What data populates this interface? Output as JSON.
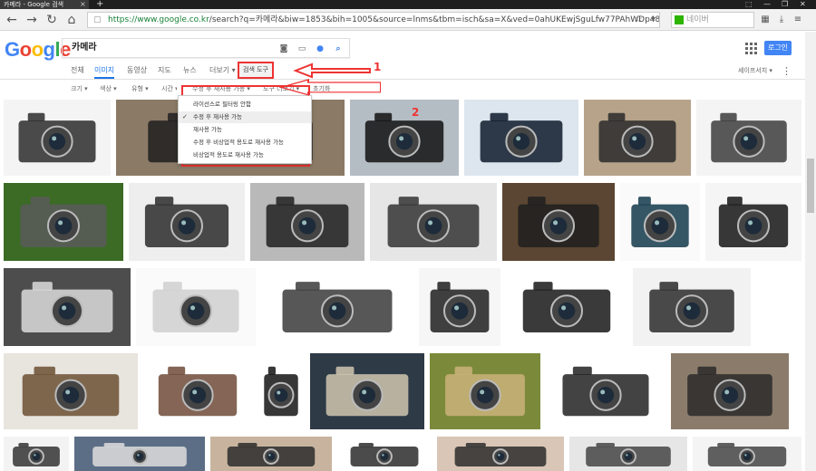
{
  "browser": {
    "tab_title": "카메라 - Google 검색",
    "tab_close": "×",
    "new_tab": "+",
    "url_secure": "https://www.google.co.kr",
    "url_rest": "/search?q=카메라&biw=1853&bih=1005&source=lnms&tbm=isch&sa=X&ved=0ahUKEwjSguLfw77PAhWDp48KHcEMA2AQ_AUIBigB#q=%EC%B9%B4%",
    "side_search_placeholder": "네이버",
    "win_min": "—",
    "win_max": "❐",
    "win_close": "✕"
  },
  "google": {
    "logo": [
      "G",
      "o",
      "o",
      "g",
      "l",
      "e"
    ],
    "query": "카메라",
    "login_label": "로그인",
    "safe_search": "세이프서치 ▾",
    "tabs": [
      "전체",
      "이미지",
      "동영상",
      "지도",
      "뉴스",
      "더보기 ▾"
    ],
    "active_tab": 1,
    "tools_button": "검색 도구",
    "tools": [
      "크기 ▾",
      "색상 ▾",
      "유형 ▾",
      "시간 ▾",
      "수정 후 재사용 가능 ▾",
      "도구 더보기 ▾",
      "초기화"
    ],
    "dropdown_items": [
      "라이선스로 필터링 안함",
      "수정 후 재사용 가능",
      "재사용 가능",
      "수정 후 비상업적 용도로 재사용 가능",
      "비상업적 용도로 재사용 가능"
    ],
    "dropdown_selected": 1,
    "check_mark": "✓"
  },
  "annotations": {
    "label_1": "1",
    "label_2": "2",
    "color": "#e33333"
  },
  "colors": {
    "accent": "#1a73e8",
    "login": "#4285f4"
  },
  "images": [
    {
      "name": "camera-image-1",
      "bg": "#f4f4f4",
      "fg": "#2b2b2b"
    },
    {
      "name": "camera-image-2",
      "bg": "#8a7a66",
      "fg": "#1f1f1f"
    },
    {
      "name": "camera-image-3",
      "bg": "#b4bcc4",
      "fg": "#121212"
    },
    {
      "name": "camera-image-4",
      "bg": "#dde6ee",
      "fg": "#0e1a2a"
    },
    {
      "name": "camera-image-5",
      "bg": "#b6a38a",
      "fg": "#2a2a2a"
    },
    {
      "name": "camera-image-6",
      "bg": "#f4f4f4",
      "fg": "#3c3c3c"
    },
    {
      "name": "camera-image-7",
      "bg": "#3b6b24",
      "fg": "#5a5a5a"
    },
    {
      "name": "camera-image-8",
      "bg": "#eeeeee",
      "fg": "#2a2a2a"
    },
    {
      "name": "camera-image-9",
      "bg": "#b9b9b9",
      "fg": "#202020"
    },
    {
      "name": "camera-image-10",
      "bg": "#e6e6e6",
      "fg": "#333333"
    },
    {
      "name": "camera-image-11",
      "bg": "#5a4632",
      "fg": "#1e1e1e"
    },
    {
      "name": "camera-image-12",
      "bg": "#fafafa",
      "fg": "#12384a"
    },
    {
      "name": "camera-image-13",
      "bg": "#f5f5f5",
      "fg": "#151515"
    },
    {
      "name": "camera-image-14",
      "bg": "#4d4d4d",
      "fg": "#dcdcdc"
    },
    {
      "name": "camera-image-15",
      "bg": "#fafafa",
      "fg": "#cfcfcf"
    },
    {
      "name": "camera-image-16",
      "bg": "#ffffff",
      "fg": "#3a3a3a"
    },
    {
      "name": "camera-image-17",
      "bg": "#f6f6f6",
      "fg": "#1e1e1e"
    },
    {
      "name": "camera-image-18",
      "bg": "#ffffff",
      "fg": "#181818"
    },
    {
      "name": "camera-image-19",
      "bg": "#f2f2f2",
      "fg": "#2c2c2c"
    },
    {
      "name": "camera-image-20",
      "bg": "#e8e4de",
      "fg": "#6b5032"
    },
    {
      "name": "camera-image-21",
      "bg": "#ffffff",
      "fg": "#6e4a38"
    },
    {
      "name": "camera-image-22",
      "bg": "#ffffff",
      "fg": "#141414"
    },
    {
      "name": "camera-image-23",
      "bg": "#2e3a46",
      "fg": "#d0c7b0"
    },
    {
      "name": "camera-image-24",
      "bg": "#7b8a3a",
      "fg": "#cbb27a"
    },
    {
      "name": "camera-image-25",
      "bg": "#ffffff",
      "fg": "#222222"
    },
    {
      "name": "camera-image-26",
      "bg": "#8b7b6b",
      "fg": "#2a2a2a"
    },
    {
      "name": "camera-image-27",
      "bg": "#f3f3f3",
      "fg": "#333333"
    },
    {
      "name": "camera-image-28",
      "bg": "#5c6e86",
      "fg": "#dddddd"
    },
    {
      "name": "camera-image-29",
      "bg": "#c8b49e",
      "fg": "#2b2b2b"
    },
    {
      "name": "camera-image-30",
      "bg": "#ffffff",
      "fg": "#2b2b2b"
    },
    {
      "name": "camera-image-31",
      "bg": "#d9c6b6",
      "fg": "#2b2b2b"
    },
    {
      "name": "camera-image-32",
      "bg": "#e6e6e6",
      "fg": "#444444"
    },
    {
      "name": "camera-image-33",
      "bg": "#f4f4f4",
      "fg": "#444444"
    }
  ]
}
